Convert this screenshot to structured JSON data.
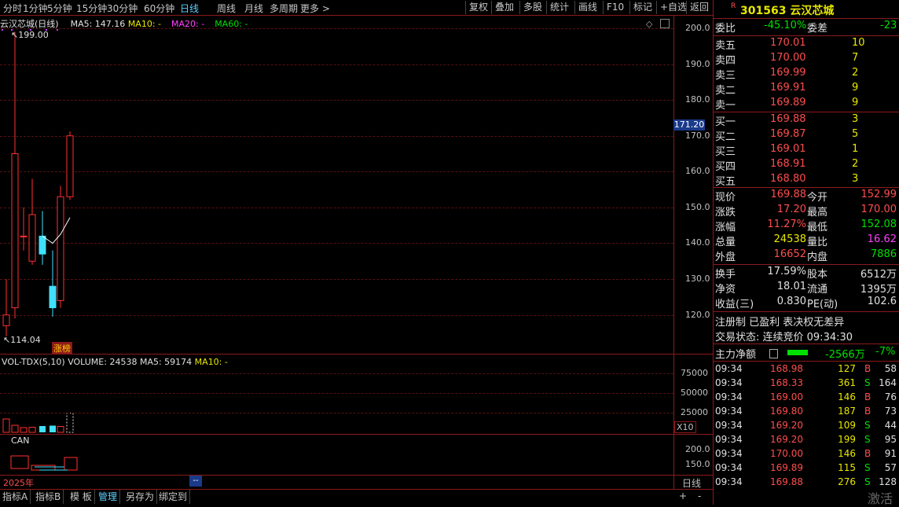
{
  "toolbar": {
    "periods": [
      "分时",
      "1分钟",
      "5分钟",
      "15分钟",
      "30分钟",
      "60分钟",
      "日线",
      "周线",
      "月线",
      "多周期",
      "更多 >"
    ],
    "active_period": "日线",
    "buttons": [
      "复权",
      "叠加",
      "多股",
      "统计",
      "画线",
      "F10",
      "标记",
      "+自选",
      "返回"
    ]
  },
  "chart": {
    "stock_label": "云汉芯城(日线)",
    "ma5": "MA5: 147.16",
    "ma10": "MA10: -",
    "ma20": "MA20: -",
    "ma60": "MA60: -",
    "high_label": "199.00",
    "low_label": "114.04",
    "badge": "涨榜",
    "price_tag": "171.20",
    "y_ticks": [
      "200.0",
      "190.0",
      "180.0",
      "170.0",
      "160.0",
      "150.0",
      "140.0",
      "130.0",
      "120.0"
    ],
    "volume_legend": "VOL-TDX(5,10)",
    "volume_value": "VOLUME: 24538",
    "volume_ma5": "MA5: 59174",
    "volume_ma10": "MA10: -",
    "volume_ticks": [
      "75000",
      "50000",
      "25000"
    ],
    "volume_unit": "X10",
    "can_label": "CAN",
    "can_ticks": [
      "200.0",
      "150.0"
    ],
    "year_label": "2025年",
    "cursor_label": "--",
    "period_label": "日线",
    "colors": {
      "up": "#ff3030",
      "down": "#40e0ff",
      "ma5": "#ffffff",
      "ma10": "#e8e800",
      "ma20": "#ff40ff",
      "ma60": "#00e000",
      "grid": "#8b1a1a"
    }
  },
  "chart_data": {
    "type": "candlestick",
    "ylim": [
      114,
      200
    ],
    "candles": [
      {
        "open": 117.0,
        "close": 120.0,
        "high": 130.0,
        "low": 114.04
      },
      {
        "open": 122.0,
        "close": 165.0,
        "high": 199.0,
        "low": 119.0
      },
      {
        "open": 142.0,
        "close": 142.0,
        "high": 150.0,
        "low": 138.0
      },
      {
        "open": 135.0,
        "close": 148.0,
        "high": 158.0,
        "low": 134.0
      },
      {
        "open": 142.0,
        "close": 137.0,
        "high": 149.0,
        "low": 134.0
      },
      {
        "open": 128.0,
        "close": 122.0,
        "high": 138.0,
        "low": 119.5
      },
      {
        "open": 124.0,
        "close": 153.0,
        "high": 156.0,
        "low": 122.0
      },
      {
        "open": 153.0,
        "close": 170.0,
        "high": 171.2,
        "low": 152.08
      }
    ],
    "ma5_line": [
      null,
      null,
      null,
      null,
      142.0,
      140.0,
      142.5,
      147.16
    ],
    "volume": [
      17000,
      9000,
      6000,
      6500,
      8000,
      8500,
      7500,
      24538
    ]
  },
  "panel": {
    "code": "301563",
    "name": "云汉芯城",
    "weibi_label": "委比",
    "weibi_value": "-45.10%",
    "weicha_label": "委差",
    "weicha_value": "-23",
    "sell": [
      {
        "label": "卖五",
        "price": "170.01",
        "vol": "10"
      },
      {
        "label": "卖四",
        "price": "170.00",
        "vol": "7"
      },
      {
        "label": "卖三",
        "price": "169.99",
        "vol": "2"
      },
      {
        "label": "卖二",
        "price": "169.91",
        "vol": "9"
      },
      {
        "label": "卖一",
        "price": "169.89",
        "vol": "9"
      }
    ],
    "buy": [
      {
        "label": "买一",
        "price": "169.88",
        "vol": "3"
      },
      {
        "label": "买二",
        "price": "169.87",
        "vol": "5"
      },
      {
        "label": "买三",
        "price": "169.01",
        "vol": "1"
      },
      {
        "label": "买四",
        "price": "168.91",
        "vol": "2"
      },
      {
        "label": "买五",
        "price": "168.80",
        "vol": "3"
      }
    ],
    "quote": [
      {
        "l1": "现价",
        "v1": "169.88",
        "c1": "red",
        "l2": "今开",
        "v2": "152.99",
        "c2": "red"
      },
      {
        "l1": "涨跌",
        "v1": "17.20",
        "c1": "red",
        "l2": "最高",
        "v2": "170.00",
        "c2": "red"
      },
      {
        "l1": "涨幅",
        "v1": "11.27%",
        "c1": "red",
        "l2": "最低",
        "v2": "152.08",
        "c2": "green"
      },
      {
        "l1": "总量",
        "v1": "24538",
        "c1": "yellow",
        "l2": "量比",
        "v2": "16.62",
        "c2": "magenta"
      },
      {
        "l1": "外盘",
        "v1": "16652",
        "c1": "red",
        "l2": "内盘",
        "v2": "7886",
        "c2": "green"
      }
    ],
    "finance": [
      {
        "l1": "换手",
        "v1": "17.59%",
        "l2": "股本",
        "v2": "6512万"
      },
      {
        "l1": "净资",
        "v1": "18.01",
        "l2": "流通",
        "v2": "1395万"
      },
      {
        "l1": "收益(三)",
        "v1": "0.830",
        "l2": "PE(动)",
        "v2": "102.6"
      }
    ],
    "tags": "注册制 已盈利 表决权无差异",
    "status": "交易状态: 连续竞价 09:34:30",
    "mainflow_label": "主力净额",
    "mainflow_value": "-2566万",
    "mainflow_pct": "-7%",
    "ticks": [
      {
        "time": "09:34",
        "price": "168.98",
        "vol": "127",
        "bs": "B",
        "n": "58"
      },
      {
        "time": "09:34",
        "price": "168.33",
        "vol": "361",
        "bs": "S",
        "n": "164"
      },
      {
        "time": "09:34",
        "price": "169.00",
        "vol": "146",
        "bs": "B",
        "n": "76"
      },
      {
        "time": "09:34",
        "price": "169.80",
        "vol": "187",
        "bs": "B",
        "n": "73"
      },
      {
        "time": "09:34",
        "price": "169.20",
        "vol": "109",
        "bs": "S",
        "n": "44"
      },
      {
        "time": "09:34",
        "price": "169.20",
        "vol": "199",
        "bs": "S",
        "n": "95"
      },
      {
        "time": "09:34",
        "price": "170.00",
        "vol": "146",
        "bs": "B",
        "n": "91"
      },
      {
        "time": "09:34",
        "price": "169.89",
        "vol": "115",
        "bs": "S",
        "n": "57"
      },
      {
        "time": "09:34",
        "price": "169.88",
        "vol": "276",
        "bs": "S",
        "n": "128"
      }
    ],
    "watermark": "激活"
  },
  "bottom_tabs": [
    "指标A",
    "指标B",
    "模 板",
    "管理",
    "另存为",
    "绑定到"
  ],
  "bottom_active": "管理",
  "bottom_controls": [
    "+",
    "-"
  ]
}
